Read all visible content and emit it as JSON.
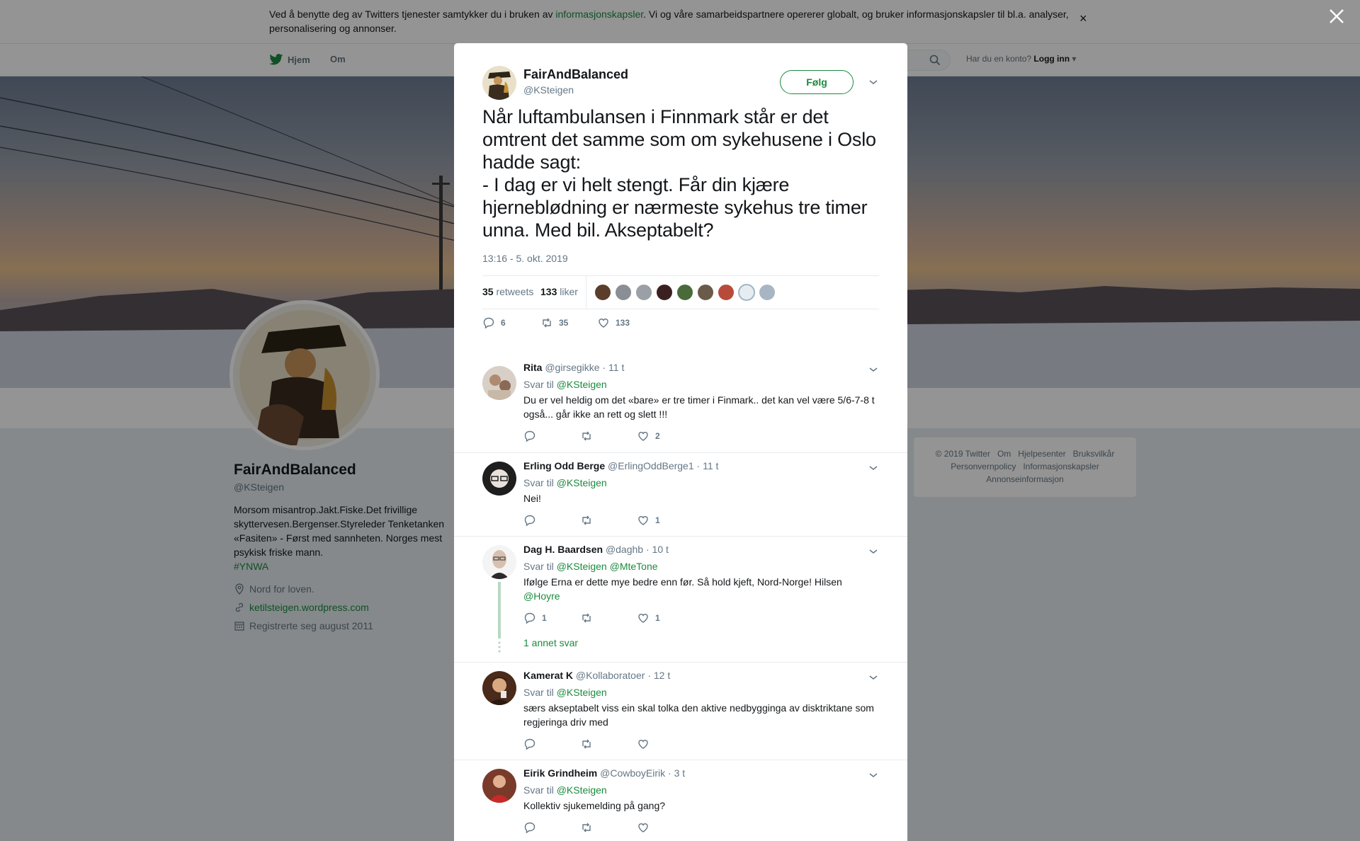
{
  "cookie_bar": {
    "text_before": "Ved å benytte deg av Twitters tjenester samtykker du i bruken av ",
    "link": "informasjonskapsler",
    "text_after": ". Vi og våre samarbeidspartnere opererer globalt, og bruker informasjonskapsler til bl.a. analyser, personalisering og annonser.",
    "close": "×"
  },
  "nav": {
    "home": "Hjem",
    "about": "Om",
    "login_prompt": "Har du en konto?",
    "login": "Logg inn"
  },
  "profile": {
    "name": "FairAndBalanced",
    "handle": "@KSteigen",
    "bio": "Morsom misantrop.Jakt.Fiske.Det frivillige skyttervesen.Bergenser.Styreleder Tenketanken «Fasiten» - Først med sannheten. Norges mest psykisk friske mann.",
    "hashtag": "#YNWA",
    "location": "Nord for loven.",
    "website": "ketilsteigen.wordpress.com",
    "joined": "Registrerte seg august 2011"
  },
  "footer": {
    "links": [
      "© 2019 Twitter",
      "Om",
      "Hjelpesenter",
      "Bruksvilkår",
      "Personvernpolicy",
      "Informasjonskapsler",
      "Annonseinformasjon"
    ]
  },
  "tweet": {
    "name": "FairAndBalanced",
    "handle": "@KSteigen",
    "follow": "Følg",
    "text": "Når luftambulansen i Finnmark står er det omtrent det samme som om sykehusene i Oslo hadde sagt:\n- I dag er vi helt stengt. Får din kjære hjerneblødning er nærmeste sykehus tre timer unna. Med bil. Akseptabelt?",
    "time": "13:16 - 5. okt. 2019",
    "retweets_count": "35",
    "retweets_label": "retweets",
    "likes_count": "133",
    "likes_label": "liker",
    "actions": {
      "replies": "6",
      "retweets": "35",
      "likes": "133"
    }
  },
  "replies": [
    {
      "name": "Rita",
      "handle": "@girsegikke",
      "time": "· 11 t",
      "reply_prefix": "Svar til",
      "reply_to": "@KSteigen",
      "text": "Du er vel heldig om det «bare» er tre timer i Finmark.. det kan vel være 5/6-7-8 t også... går ikke an rett og slett !!!",
      "replies": "",
      "retweets": "",
      "likes": "2"
    },
    {
      "name": "Erling Odd Berge",
      "handle": "@ErlingOddBerge1",
      "time": "· 11 t",
      "reply_prefix": "Svar til",
      "reply_to": "@KSteigen",
      "text": "Nei!",
      "replies": "",
      "retweets": "",
      "likes": "1"
    },
    {
      "name": "Dag H. Baardsen",
      "handle": "@daghb",
      "time": "· 10 t",
      "reply_prefix": "Svar til",
      "reply_to": "@KSteigen @MteTone",
      "text": "Ifølge Erna er dette mye bedre enn før. Så hold kjeft, Nord-Norge! Hilsen ",
      "text_link": "@Hoyre",
      "replies": "1",
      "retweets": "",
      "likes": "1",
      "more": "1 annet svar"
    },
    {
      "name": "Kamerat K",
      "handle": "@Kollaboratoer",
      "time": "· 12 t",
      "reply_prefix": "Svar til",
      "reply_to": "@KSteigen",
      "text": "særs akseptabelt viss ein skal tolka den aktive nedbygginga av disktriktane som regjeringa driv med",
      "replies": "",
      "retweets": "",
      "likes": ""
    },
    {
      "name": "Eirik Grindheim",
      "handle": "@CowboyEirik",
      "time": "· 3 t",
      "reply_prefix": "Svar til",
      "reply_to": "@KSteigen",
      "text": "Kollektiv sjukemelding på gang?",
      "replies": "",
      "retweets": "",
      "likes": ""
    }
  ],
  "colors": {
    "accent": "#1b8a3e",
    "muted": "#657786",
    "text": "#14171a"
  }
}
